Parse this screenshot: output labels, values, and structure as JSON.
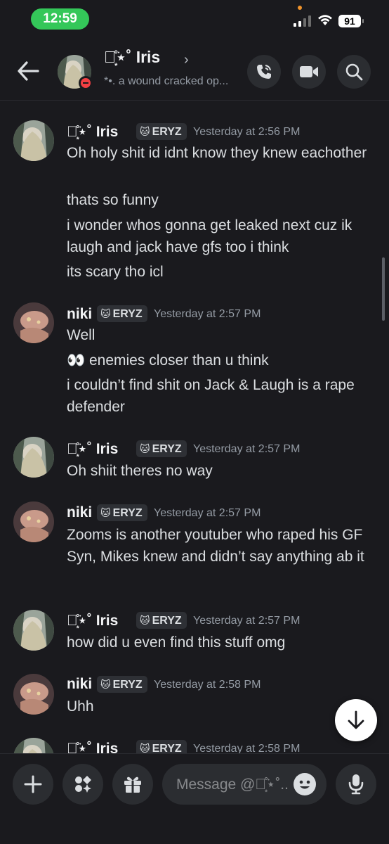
{
  "status_bar": {
    "time": "12:59",
    "battery": "91"
  },
  "header": {
    "name": "☥͙̊͘⋆˚ Iris",
    "chevron": "›",
    "status_text": "*•. a wound cracked op..."
  },
  "messages": [
    {
      "author": "☥͙̊͘⋆˚ Iris",
      "tag": "ERYZ",
      "timestamp": "Yesterday at 2:56 PM",
      "lines": [
        "Oh holy shit id idnt know they knew eachother",
        "thats so funny",
        "i wonder whos gonna get leaked next cuz ik laugh and jack have gfs too i think",
        "its scary tho icl"
      ]
    },
    {
      "author": "niki",
      "tag": "ERYZ",
      "timestamp": "Yesterday at 2:57 PM",
      "lines": [
        "Well",
        "👀 enemies closer than u think",
        "i couldn’t find shit on Jack & Laugh is a rape defender"
      ]
    },
    {
      "author": "☥͙̊͘⋆˚ Iris",
      "tag": "ERYZ",
      "timestamp": "Yesterday at 2:57 PM",
      "lines": [
        "Oh shiit theres no way"
      ]
    },
    {
      "author": "niki",
      "tag": "ERYZ",
      "timestamp": "Yesterday at 2:57 PM",
      "lines": [
        "Zooms is another youtuber who raped his GF Syn, Mikes knew and didn’t say anything ab it"
      ]
    },
    {
      "author": "☥͙̊͘⋆˚ Iris",
      "tag": "ERYZ",
      "timestamp": "Yesterday at 2:57 PM",
      "lines": [
        "how did u even find this stuff omg"
      ]
    },
    {
      "author": "niki",
      "tag": "ERYZ",
      "timestamp": "Yesterday at 2:58 PM",
      "lines": [
        "Uhh"
      ]
    },
    {
      "author": "☥͙̊͘⋆˚ Iris",
      "tag": "ERYZ",
      "timestamp": "Yesterday at 2:58 PM",
      "lines": []
    }
  ],
  "composer": {
    "placeholder": "Message @☥͙̊͘⋆˚.."
  },
  "icons": [
    "back-arrow-icon",
    "phone-icon",
    "video-camera-icon",
    "search-icon",
    "plus-icon",
    "apps-icon",
    "gift-icon",
    "emoji-icon",
    "microphone-icon",
    "jump-to-bottom-icon"
  ],
  "colors": {
    "background": "#1a1a1e",
    "dnd_status": "#f23f43",
    "time_pill": "#34c759"
  }
}
